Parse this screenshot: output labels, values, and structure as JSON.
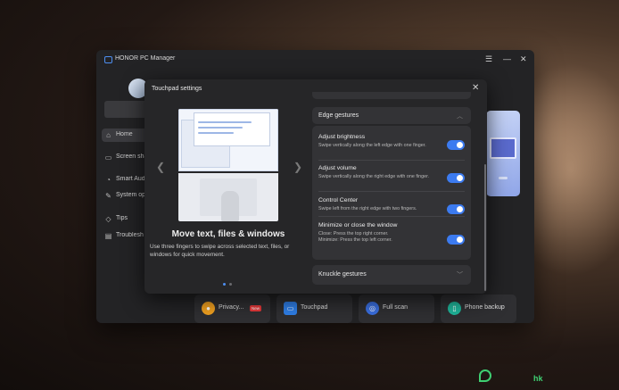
{
  "app": {
    "title": "HONOR PC Manager",
    "menu_icon": "menu-icon",
    "minimize_icon": "minimize-icon",
    "close_icon": "close-icon"
  },
  "sidebar": {
    "items": [
      {
        "label": "Home",
        "icon": "home-icon",
        "active": true
      },
      {
        "label": "Screen sha",
        "icon": "screen-share-icon"
      },
      {
        "label": "Smart Aud",
        "icon": "smart-audio-icon"
      },
      {
        "label": "System op",
        "icon": "system-optimization-icon"
      },
      {
        "label": "Tips",
        "icon": "tips-icon"
      },
      {
        "label": "Troublesh",
        "icon": "troubleshooting-icon"
      }
    ]
  },
  "quick_actions": [
    {
      "label": "Privacy...",
      "icon": "privacy-icon",
      "color": "#f0a020",
      "badge": "New"
    },
    {
      "label": "Touchpad",
      "icon": "touchpad-icon",
      "color": "#2f7fe8"
    },
    {
      "label": "Full scan",
      "icon": "full-scan-icon",
      "color": "#3a6fe0"
    },
    {
      "label": "Phone backup",
      "icon": "phone-backup-icon",
      "color": "#1fb59a"
    }
  ],
  "dialog": {
    "title": "Touchpad settings",
    "close_icon": "close-icon",
    "slide": {
      "title": "Move text, files & windows",
      "description": "Use three fingers to swipe across selected text, files, or windows for quick movement.",
      "prev_icon": "chevron-left-icon",
      "next_icon": "chevron-right-icon"
    },
    "edge_gestures": {
      "title": "Edge gestures",
      "rows": [
        {
          "title": "Adjust brightness",
          "description": "Swipe vertically along the left edge with one finger.",
          "enabled": true
        },
        {
          "title": "Adjust volume",
          "description": "Swipe vertically along the right edge with one finger.",
          "enabled": true
        },
        {
          "title": "Control Center",
          "description": "Swipe left from the right edge with two fingers.",
          "enabled": true
        },
        {
          "title": "Minimize or close the window",
          "description": "Close: Press the top right corner.",
          "description2": "Minimize: Press the top left corner.",
          "enabled": true
        }
      ]
    },
    "knuckle_gestures": {
      "title": "Knuckle gestures"
    }
  },
  "colors": {
    "accent": "#3c7bf0",
    "badge": "#e5393a",
    "brand": "#3fcf72"
  },
  "watermark": {
    "text": "hk"
  }
}
